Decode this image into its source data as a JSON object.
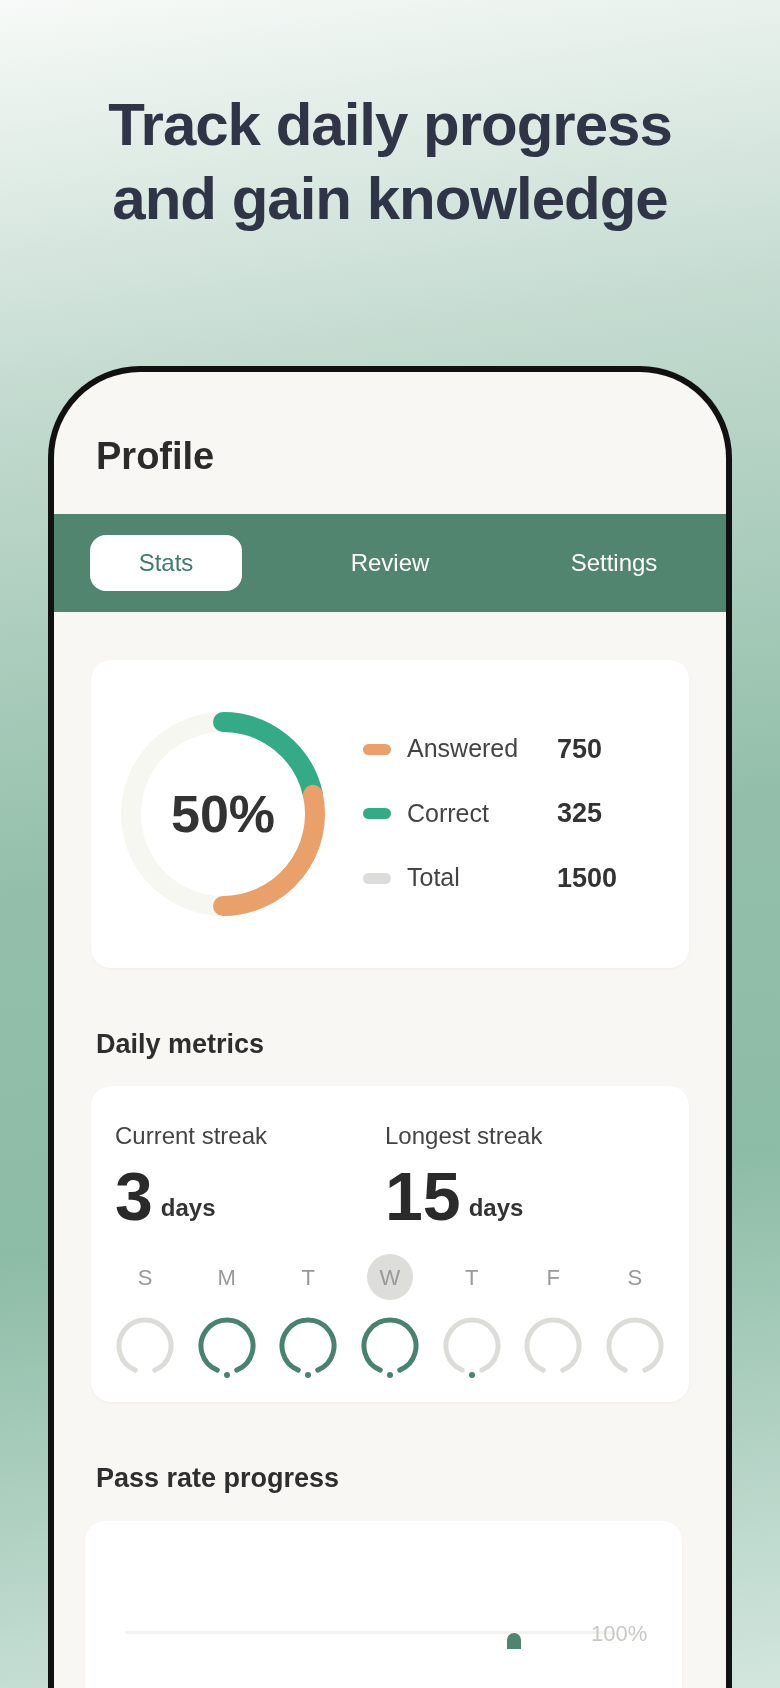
{
  "headline": "Track daily progress and gain knowledge",
  "screen": {
    "title": "Profile",
    "tabs": [
      {
        "label": "Stats",
        "selected": true
      },
      {
        "label": "Review",
        "selected": false
      },
      {
        "label": "Settings",
        "selected": false
      }
    ],
    "summary": {
      "percent": "50%",
      "legend": [
        {
          "label": "Answered",
          "value": "750",
          "color": "#e9a06a",
          "kind": "part"
        },
        {
          "label": "Correct",
          "value": "325",
          "color": "#34aa86",
          "kind": "part"
        },
        {
          "label": "Total",
          "value": "1500",
          "color": "#dcdcda",
          "kind": "total"
        }
      ]
    },
    "daily_metrics": {
      "heading": "Daily metrics",
      "streaks": [
        {
          "label": "Current streak",
          "number": "3",
          "unit": "days"
        },
        {
          "label": "Longest streak",
          "number": "15",
          "unit": "days"
        }
      ],
      "week": [
        {
          "day": "S",
          "selected": false,
          "done": false,
          "dot": false
        },
        {
          "day": "M",
          "selected": false,
          "done": true,
          "dot": true
        },
        {
          "day": "T",
          "selected": false,
          "done": true,
          "dot": true
        },
        {
          "day": "W",
          "selected": true,
          "done": true,
          "dot": true
        },
        {
          "day": "T",
          "selected": false,
          "done": false,
          "dot": true
        },
        {
          "day": "F",
          "selected": false,
          "done": false,
          "dot": false
        },
        {
          "day": "S",
          "selected": false,
          "done": false,
          "dot": false
        }
      ]
    },
    "pass_rate": {
      "heading": "Pass rate progress",
      "tick_label": "100%"
    }
  }
}
